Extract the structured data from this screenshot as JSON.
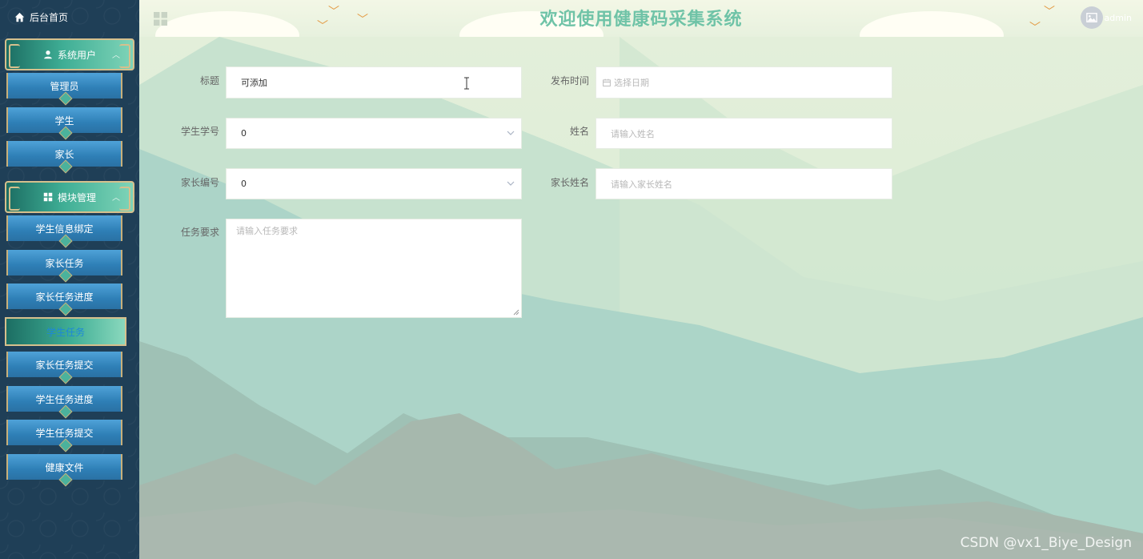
{
  "sidebar": {
    "home_label": "后台首页",
    "groups": [
      {
        "label": "系统用户",
        "items": [
          "管理员",
          "学生",
          "家长"
        ]
      },
      {
        "label": "模块管理",
        "items": [
          "学生信息绑定",
          "家长任务",
          "家长任务进度",
          "学生任务",
          "家长任务提交",
          "学生任务进度",
          "学生任务提交",
          "健康文件"
        ]
      }
    ],
    "active_item": "学生任务"
  },
  "header": {
    "title": "欢迎使用健康码采集系统",
    "username": "admin"
  },
  "form": {
    "title": {
      "label": "标题",
      "value": "可添加"
    },
    "publish_time": {
      "label": "发布时间",
      "placeholder": "选择日期"
    },
    "student_no": {
      "label": "学生学号",
      "value": "0"
    },
    "name": {
      "label": "姓名",
      "placeholder": "请输入姓名"
    },
    "parent_no": {
      "label": "家长编号",
      "value": "0"
    },
    "parent_name": {
      "label": "家长姓名",
      "placeholder": "请输入家长姓名"
    },
    "task_req": {
      "label": "任务要求",
      "placeholder": "请输入任务要求"
    }
  },
  "watermark": "CSDN @vx1_Biye_Design",
  "colors": {
    "sidebar_bg": "#1f3f57",
    "menu_blue": "#2e7fb6",
    "accent_teal": "#3fae95",
    "title_green": "#6fc3a7",
    "gold_border": "#d6c08d"
  }
}
